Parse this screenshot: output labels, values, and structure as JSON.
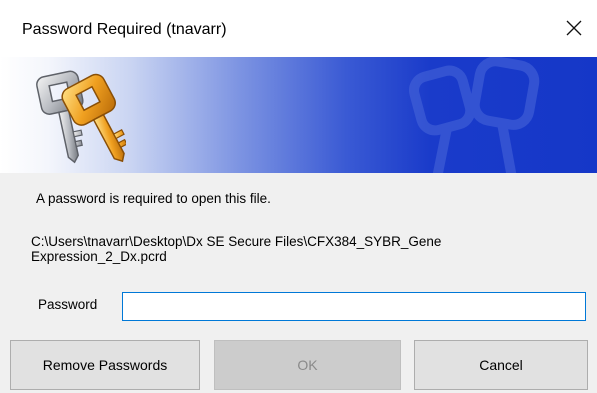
{
  "window": {
    "title": "Password Required (tnavarr)",
    "close_icon": "close-icon"
  },
  "banner": {
    "icon": "keys-icon",
    "gradient_colors": [
      "#ffffff",
      "#1537c8"
    ]
  },
  "message": {
    "info": "A password is required to open this file.",
    "file_path": "C:\\Users\\tnavarr\\Desktop\\Dx SE Secure Files\\CFX384_SYBR_Gene\nExpression_2_Dx.pcrd"
  },
  "password_field": {
    "label": "Password",
    "value": "",
    "focus_border_color": "#0078d7"
  },
  "buttons": {
    "remove_label": "Remove Passwords",
    "ok_label": "OK",
    "ok_enabled": false,
    "cancel_label": "Cancel"
  }
}
